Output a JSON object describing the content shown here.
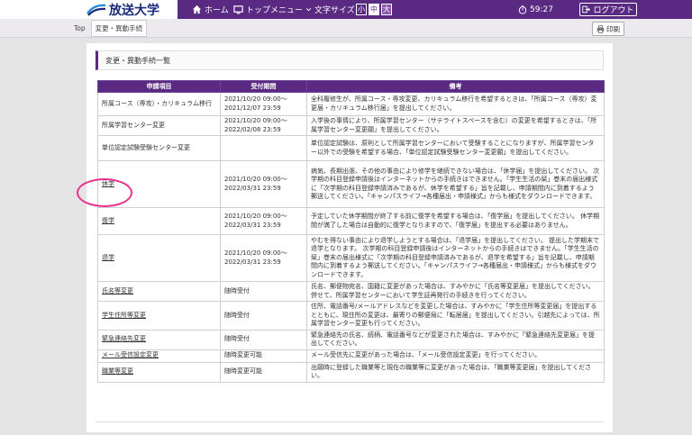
{
  "app": {
    "logo_text": "放送大学"
  },
  "topbar": {
    "home_label": "ホーム",
    "top_menu_label": "トップメニュー",
    "font_size_label": "文字サイズ",
    "font_sizes": [
      "小",
      "中",
      "大"
    ],
    "timer": "59:27",
    "logout_label": "ログアウト"
  },
  "subbar": {
    "breadcrumb_top": "Top",
    "breadcrumb_current": "変更・異動手続",
    "print_label": "印刷"
  },
  "main": {
    "section_title": "変更・異動手続一覧",
    "table": {
      "headers": [
        "申請項目",
        "受付期間",
        "備考"
      ],
      "rows": [
        {
          "item": "所属コース（専攻）・カリキュラム移行",
          "link": false,
          "period": "2021/10/20 09:00～ 2021/12/07 23:59",
          "note": "全科履修生が、所属コース・専攻変更、カリキュラム移行を希望するときは、「所属コース（専攻）変更届・カリキュラム移行届」を提出してください。"
        },
        {
          "item": "所属学習センター変更",
          "link": false,
          "period": "2021/10/20 09:00～ 2022/02/08 23:59",
          "note": "入学後の事情により、所属学習センター（サテライトスペースを含む）の変更を希望するときは、「所属学習センター変更願」を提出してください。"
        },
        {
          "item": "単位認定試験受験センター変更",
          "link": false,
          "period": "",
          "note": "単位認定試験は、原則として所属学習センターにおいて受験することになりますが、所属学習センター以外での受験を希望する場合、「単位認定試験受験センター変更願」を提出してください。"
        },
        {
          "item": "休学",
          "link": true,
          "period": "2021/10/20 09:00～ 2022/03/31 23:59",
          "note": "病気、長期出張、その他の事由により修学を継続できない場合は、「休学届」を提出してください。 次学期の科目登録申請後はインターネットからの手続きはできません。「学生生活の栞」巻末の届出様式に「次学期の科目登録申請済みであるが、休学を希望する」旨を記載し、申請期間内に到着するよう郵送してください。「キャンパスライフ→各種届出・申請様式」からも様式をダウンロードできます。"
        },
        {
          "item": "復学",
          "link": true,
          "period": "2021/10/20 09:00～ 2022/03/31 23:59",
          "note": "予定していた休学期間が終了する前に復学を希望する場合は、「復学届」を提出してください。 休学期間が満了した場合は自動的に復学となりますので、「復学届」を提出する必要はありません。"
        },
        {
          "item": "退学",
          "link": true,
          "period": "2021/10/20 09:00～ 2022/03/31 23:59",
          "note": "やむを得ない事由により退学しようとする場合は、「退学届」を提出してください。 提出した学期末で退学となります。 次学期の科目登録申請後はインターネットからの手続きはできません。「学生生活の栞」巻末の届出様式に「次学期の科目登録申請済みであるが、退学を希望する」旨を記載し、申請期間内に到着するよう郵送してください。「キャンパスライフ→各種届出・申請様式」からも様式をダウンロードできます。"
        },
        {
          "item": "氏名等変更",
          "link": true,
          "period": "随時受付",
          "note": "氏名、郵便物宛名、国籍に変更があった場合は、すみやかに「氏名等変更届」を提出してください。 併せて、所属学習センターにおいて学生証再発行の手続きを行ってください。"
        },
        {
          "item": "学生住所等変更",
          "link": true,
          "period": "随時受付",
          "note": "住所、電話番号/メールアドレスなどを変更した場合は、すみやかに「学生住所等変更届」を提出するとともに、現住所の変更は、最寄りの郵便局に「転居届」を提出してください。引越先によっては、所属学習センター変更も行ってください。"
        },
        {
          "item": "緊急連絡先変更",
          "link": true,
          "period": "随時受付",
          "note": "緊急連絡先の氏名、続柄、電話番号などが変更された場合は、すみやかに「緊急連絡先変更届」を提出してください。"
        },
        {
          "item": "メール受信設定変更",
          "link": true,
          "period": "随時変更可能",
          "note": "メール受信先に変更があった場合は、「メール受信設定変更」を行ってください。"
        },
        {
          "item": "職業等変更",
          "link": true,
          "period": "随時変更可能",
          "note": "出願時に登録した職業等と現在の職業等に変更があった場合は、「職業等変更届」を提出してください。"
        }
      ]
    }
  },
  "colors": {
    "brand_purple": "#5a2a82",
    "highlight_pink": "#e8308c"
  }
}
